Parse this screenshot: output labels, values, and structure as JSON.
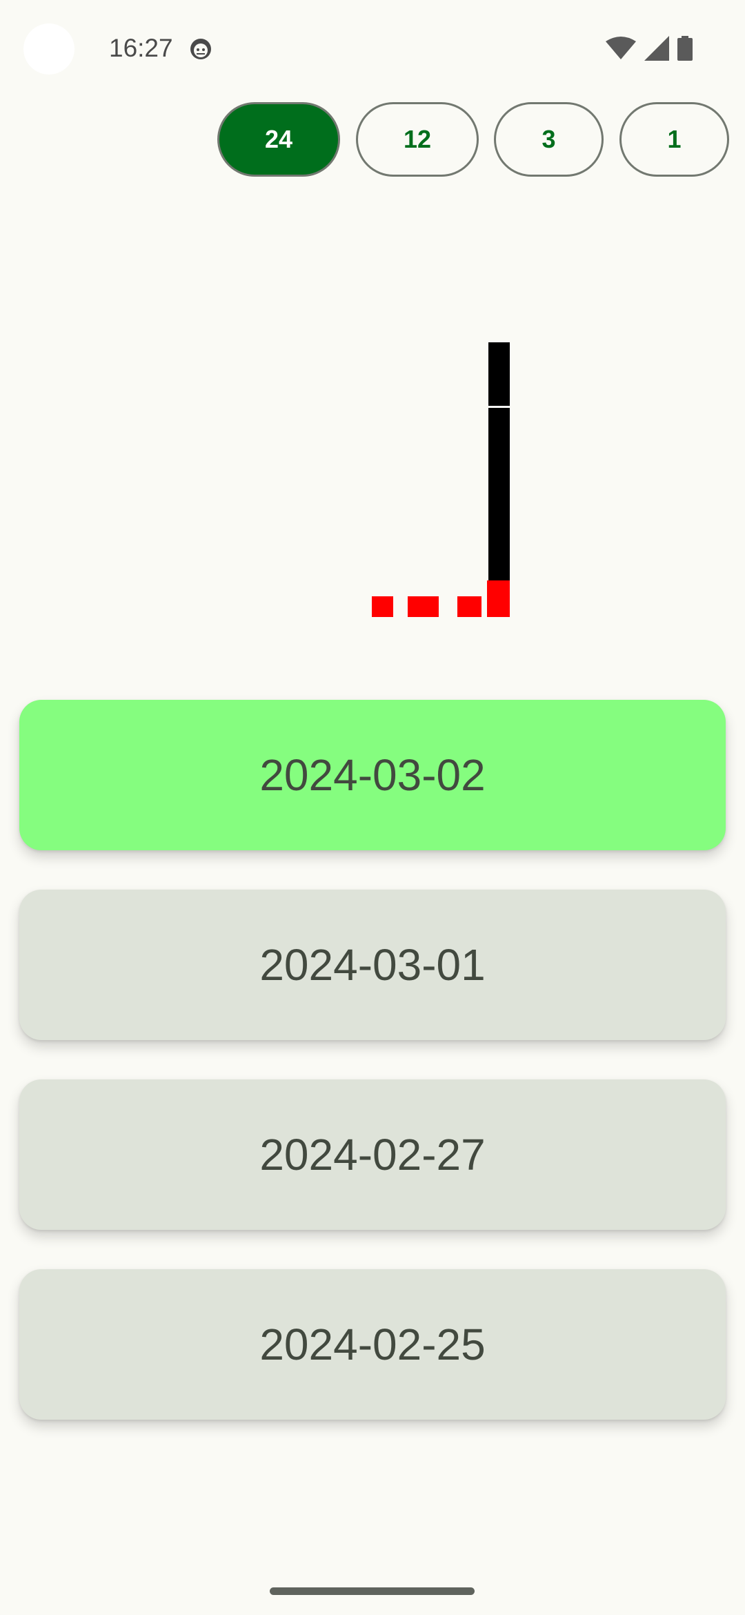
{
  "status_bar": {
    "time": "16:27",
    "app_icon": "android-face-icon",
    "icons": [
      "wifi-icon",
      "cell-signal-icon",
      "battery-icon"
    ]
  },
  "range_selector": {
    "options": [
      {
        "label": "24",
        "selected": true
      },
      {
        "label": "12",
        "selected": false
      },
      {
        "label": "3",
        "selected": false
      },
      {
        "label": "1",
        "selected": false
      }
    ]
  },
  "chart_data": {
    "type": "bar",
    "series": [
      {
        "color": "#ff0000",
        "marks": [
          "d1",
          "d2",
          "d3",
          "d4"
        ]
      },
      {
        "color": "#000000",
        "marks": [
          "d4"
        ]
      }
    ]
  },
  "dates": [
    {
      "label": "2024-03-02",
      "selected": true
    },
    {
      "label": "2024-03-01",
      "selected": false
    },
    {
      "label": "2024-02-27",
      "selected": false
    },
    {
      "label": "2024-02-25",
      "selected": false
    }
  ],
  "colors": {
    "accent": "#006e1c",
    "selected_card": "#85fd7f",
    "card": "#dee3d9",
    "background": "#fafaf5"
  }
}
